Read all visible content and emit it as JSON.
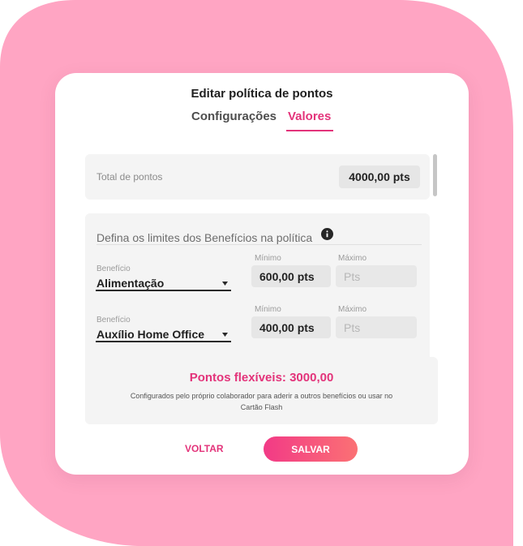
{
  "modal": {
    "title": "Editar política de pontos",
    "tabs": [
      {
        "label": "Configurações"
      },
      {
        "label": "Valores"
      }
    ]
  },
  "total": {
    "label": "Total de pontos",
    "value": "4000,00 pts"
  },
  "limits": {
    "title": "Defina os limites dos Benefícios na política",
    "info_icon": "info-icon",
    "rows": [
      {
        "benefit_caption": "Benefício",
        "benefit_value": "Alimentação",
        "min_caption": "Mínimo",
        "min_value": "600,00 pts",
        "max_caption": "Máximo",
        "max_placeholder": "Pts"
      },
      {
        "benefit_caption": "Benefício",
        "benefit_value": "Auxílio Home Office",
        "min_caption": "Mínimo",
        "min_value": "400,00 pts",
        "max_caption": "Máximo",
        "max_placeholder": "Pts"
      }
    ]
  },
  "flex": {
    "title": "Pontos flexíveis: 3000,00",
    "description": "Configurados pelo próprio colaborador para aderir a outros benefícios ou usar no Cartão Flash"
  },
  "actions": {
    "back_label": "VOLTAR",
    "save_label": "SALVAR"
  },
  "colors": {
    "accent": "#e3337a",
    "background_blob": "#ffa5c3",
    "button_gradient_start": "#f23a86",
    "button_gradient_end": "#fb7174"
  }
}
